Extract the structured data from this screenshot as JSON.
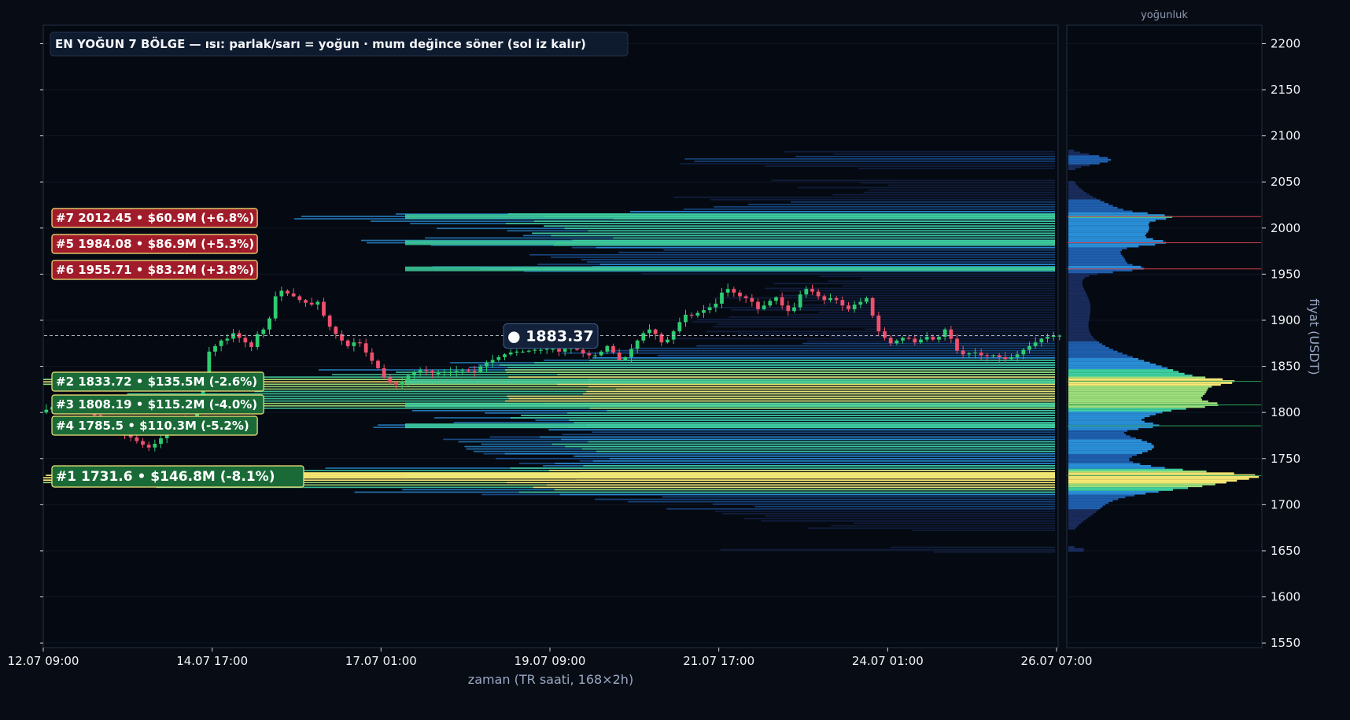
{
  "chart_data": {
    "type": "candlestick_heatmap",
    "title": "EN YOĞUN 7 BÖLGE — ısı: parlak/sarı = yoğun · mum değince söner (sol iz kalır)",
    "xlabel": "zaman (TR saati, 168×2h)",
    "ylabel": "fiyat (USDT)",
    "side_label": "yoğunluk",
    "ylim": [
      1545,
      2220
    ],
    "y_ticks": [
      1550,
      1600,
      1650,
      1700,
      1750,
      1800,
      1850,
      1900,
      1950,
      2000,
      2050,
      2100,
      2150,
      2200
    ],
    "x_range_bars": [
      0,
      168
    ],
    "x_ticks": [
      {
        "bar": 0,
        "label": "12.07 09:00"
      },
      {
        "bar": 28,
        "label": "14.07 17:00"
      },
      {
        "bar": 56,
        "label": "17.07 01:00"
      },
      {
        "bar": 84,
        "label": "19.07 09:00"
      },
      {
        "bar": 112,
        "label": "21.07 17:00"
      },
      {
        "bar": 140,
        "label": "24.07 01:00"
      },
      {
        "bar": 168,
        "label": "26.07 07:00"
      }
    ],
    "current_price": 1883.37,
    "current_price_label": "● 1883.37",
    "price_path": [
      1800,
      1803,
      1806,
      1810,
      1813,
      1811,
      1808,
      1806,
      1803,
      1797,
      1794,
      1790,
      1786,
      1782,
      1777,
      1773,
      1769,
      1765,
      1762,
      1766,
      1772,
      1779,
      1786,
      1791,
      1788,
      1794,
      1808,
      1832,
      1866,
      1872,
      1878,
      1880,
      1886,
      1881,
      1876,
      1871,
      1885,
      1890,
      1902,
      1926,
      1932,
      1929,
      1926,
      1922,
      1919,
      1917,
      1920,
      1905,
      1893,
      1885,
      1878,
      1872,
      1876,
      1875,
      1865,
      1856,
      1848,
      1838,
      1832,
      1830,
      1834,
      1840,
      1844,
      1846,
      1845,
      1843,
      1843,
      1844,
      1844,
      1845,
      1846,
      1845,
      1844,
      1850,
      1854,
      1857,
      1860,
      1863,
      1865,
      1866,
      1866,
      1867,
      1868,
      1868,
      1869,
      1869,
      1866,
      1869,
      1873,
      1868,
      1864,
      1862,
      1862,
      1866,
      1872,
      1865,
      1857,
      1860,
      1869,
      1878,
      1886,
      1890,
      1885,
      1876,
      1879,
      1888,
      1898,
      1906,
      1905,
      1908,
      1911,
      1914,
      1918,
      1930,
      1934,
      1930,
      1926,
      1924,
      1920,
      1912,
      1916,
      1921,
      1925,
      1916,
      1910,
      1914,
      1928,
      1934,
      1931,
      1926,
      1922,
      1924,
      1922,
      1916,
      1912,
      1917,
      1920,
      1924,
      1905,
      1888,
      1881,
      1875,
      1878,
      1881,
      1880,
      1876,
      1879,
      1882,
      1879,
      1882,
      1890,
      1880,
      1867,
      1863,
      1864,
      1865,
      1862,
      1861,
      1862,
      1860,
      1858,
      1860,
      1863,
      1868,
      1872,
      1876,
      1880,
      1882,
      1883,
      1883.37
    ],
    "zones": [
      {
        "rank": "#7",
        "price": 2012.45,
        "volume": "$60.9M",
        "change": "(+6.8%)",
        "label": "#7  2012.45  •  $60.9M  (+6.8%)",
        "side": "above"
      },
      {
        "rank": "#5",
        "price": 1984.08,
        "volume": "$86.9M",
        "change": "(+5.3%)",
        "label": "#5  1984.08  •  $86.9M  (+5.3%)",
        "side": "above"
      },
      {
        "rank": "#6",
        "price": 1955.71,
        "volume": "$83.2M",
        "change": "(+3.8%)",
        "label": "#6  1955.71  •  $83.2M  (+3.8%)",
        "side": "above"
      },
      {
        "rank": "#2",
        "price": 1833.72,
        "volume": "$135.5M",
        "change": "(-2.6%)",
        "label": "#2  1833.72  •  $135.5M  (-2.6%)",
        "side": "below"
      },
      {
        "rank": "#3",
        "price": 1808.19,
        "volume": "$115.2M",
        "change": "(-4.0%)",
        "label": "#3  1808.19  •  $115.2M  (-4.0%)",
        "side": "below"
      },
      {
        "rank": "#4",
        "price": 1785.5,
        "volume": "$110.3M",
        "change": "(-5.2%)",
        "label": "#4  1785.5  •  $110.3M  (-5.2%)",
        "side": "below"
      },
      {
        "rank": "#1",
        "price": 1731.6,
        "volume": "$146.8M",
        "change": "(-8.1%)",
        "label": "#1  1731.6  •  $146.8M  (-8.1%)",
        "side": "below"
      }
    ],
    "profile_clusters": [
      {
        "center": 2074,
        "sigma": 5,
        "weight": 0.22
      },
      {
        "center": 2000,
        "sigma": 22,
        "weight": 0.42
      },
      {
        "center": 1962,
        "sigma": 8,
        "weight": 0.18
      },
      {
        "center": 1915,
        "sigma": 22,
        "weight": 0.11
      },
      {
        "center": 1825,
        "sigma": 28,
        "weight": 0.72
      },
      {
        "center": 1762,
        "sigma": 10,
        "weight": 0.38
      },
      {
        "center": 1728,
        "sigma": 11,
        "weight": 0.82
      },
      {
        "center": 1700,
        "sigma": 15,
        "weight": 0.16
      },
      {
        "center": 1651,
        "sigma": 2,
        "weight": 0.09
      }
    ],
    "colors": {
      "background": "#080c14",
      "plot_background": "#050a12",
      "border": "#243044",
      "bull": "#2ecc71",
      "bear": "#f0506e",
      "zone_above_fill": "#a01c2a",
      "zone_below_fill": "#1a6a38",
      "zone_border": "#f7e77a",
      "heat_low": "#1a2c5c",
      "heat_mid": "#2a8fd8",
      "heat_high": "#3fd0a0",
      "heat_peak": "#f7e874"
    }
  }
}
